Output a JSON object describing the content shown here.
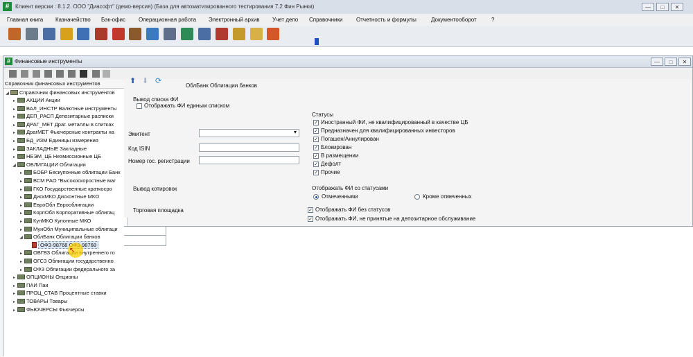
{
  "window": {
    "title": "Клиент версии : 8.1.2. ООО \"Диасофт\" (демо-версия) (База для автоматизированного тестирования 7.2 Фин Рынки)",
    "app_icon": "#",
    "controls": {
      "minimize": "—",
      "maximize": "□",
      "close": "✕"
    }
  },
  "menu": [
    "Главная книга",
    "Казначейство",
    "Бэк-офис",
    "Операционная работа",
    "Электронный архив",
    "Учет депо",
    "Справочники",
    "Отчетность и формулы",
    "Документооборот",
    "?"
  ],
  "toolbar_icons": [
    "people-icon",
    "calc-icon",
    "document-icon",
    "notebook-icon",
    "chart-icon",
    "book-icon",
    "car-icon",
    "users-icon",
    "computer-icon",
    "bank-icon",
    "cash-icon",
    "monitor-icon",
    "bag-icon",
    "box-icon",
    "documents-icon",
    "stamp-icon"
  ],
  "toolbar_colors": {
    "people-icon": "#c0662a",
    "calc-icon": "#6c7c8c",
    "document-icon": "#4a6fa5",
    "notebook-icon": "#d8a11c",
    "chart-icon": "#3f6fb5",
    "book-icon": "#a83b2b",
    "car-icon": "#c0392b",
    "users-icon": "#8a5a2b",
    "computer-icon": "#3a7bbf",
    "bank-icon": "#5f6f8a",
    "cash-icon": "#2e8b57",
    "monitor-icon": "#4a6fa5",
    "bag-icon": "#b03a2e",
    "box-icon": "#c49a2c",
    "documents-icon": "#d7b04a",
    "stamp-icon": "#d2582a"
  },
  "child_window": {
    "title": "Финансовые инструменты",
    "app_icon": "#",
    "controls": {
      "minimize": "—",
      "maximize": "□",
      "close": "✕"
    },
    "tools": [
      "list-icon",
      "filter-icon",
      "filter-off-icon",
      "search-icon",
      "print-icon",
      "zoom-icon",
      "binoculars-icon",
      "refresh-icon",
      "back-icon"
    ]
  },
  "tree": {
    "header": "Справочник финансовых инструментов",
    "root": "Справочник финансовых инструментов",
    "items": [
      {
        "label": "АКЦИИ Акции",
        "level": 1,
        "exp": "▸"
      },
      {
        "label": "ВАЛ_ИНСТР Валютные инструменты",
        "level": 1,
        "exp": "▸"
      },
      {
        "label": "ДЕП_РАСП Депозитарные расписки",
        "level": 1,
        "exp": "▸"
      },
      {
        "label": "ДРАГ_МЕТ Драг. металлы в слитках",
        "level": 1,
        "exp": "▸"
      },
      {
        "label": "ДрагМЕТ Фьючерсные контракты на",
        "level": 1,
        "exp": "▸"
      },
      {
        "label": "ЕД_ИЗМ Единицы измерения",
        "level": 1,
        "exp": "▸"
      },
      {
        "label": "ЗАКЛАДНЫЕ Закладные",
        "level": 1,
        "exp": "▸"
      },
      {
        "label": "НЕЭМ_ЦБ Неэмиссионные ЦБ",
        "level": 1,
        "exp": "▸"
      },
      {
        "label": "ОБЛИГАЦИИ Облигации",
        "level": 1,
        "exp": "◢"
      },
      {
        "label": "БОБР Бескупонные облигации Банк",
        "level": 2,
        "exp": "▸"
      },
      {
        "label": "ВСМ РАО \"Высокоскоростные маг",
        "level": 2,
        "exp": "▸"
      },
      {
        "label": "ГКО Государственные краткосро",
        "level": 2,
        "exp": "▸"
      },
      {
        "label": "ДискМКО Дисконтные МКО",
        "level": 2,
        "exp": "▸"
      },
      {
        "label": "ЕвроОбл Еврооблигации",
        "level": 2,
        "exp": "▸"
      },
      {
        "label": "КорпОбл Корпоративные облигац",
        "level": 2,
        "exp": "▸"
      },
      {
        "label": "КупМКО Купонные МКО",
        "level": 2,
        "exp": "▸"
      },
      {
        "label": "МунОбл Муниципальные облигаци",
        "level": 2,
        "exp": "▸"
      },
      {
        "label": "ОблБанк Облигации банков",
        "level": 2,
        "exp": "◢"
      },
      {
        "label": "ОФЗ-98768 ОФЗ-98768",
        "level": 3,
        "exp": "",
        "doc": true,
        "selected": true
      },
      {
        "label": "ОВГВЗ Облигации внутреннего го",
        "level": 2,
        "exp": "▸"
      },
      {
        "label": "ОГСЗ Облигации государственно",
        "level": 2,
        "exp": "▸"
      },
      {
        "label": "ОФЗ Облигации федерального за",
        "level": 2,
        "exp": "▸"
      },
      {
        "label": "ОПЦИОНЫ Опционы",
        "level": 1,
        "exp": "▸"
      },
      {
        "label": "ПАИ Паи",
        "level": 1,
        "exp": "▸"
      },
      {
        "label": "ПРОЦ_СТАВ Процентные ставки",
        "level": 1,
        "exp": "▸"
      },
      {
        "label": "ТОВАРЫ Товары",
        "level": 1,
        "exp": "▸"
      },
      {
        "label": "ФЬЮЧЕРСЫ Фьючерсы",
        "level": 1,
        "exp": "▸"
      }
    ]
  },
  "filter": {
    "path_label": "ОблБанк Облигации банков",
    "section_output": "Вывод списка ФИ",
    "single_list": "Отображать ФИ единым списком",
    "issuer_label": "Эмитент",
    "isin_label": "Код ISIN",
    "regnum_label": "Номер гос. регистрации",
    "quotes_label": "Вывод котировок",
    "trading_label": "Торговая площадка",
    "statuses_title": "Статусы",
    "statuses": [
      "Иностранный ФИ, не квалифицированный в качестве ЦБ",
      "Предназначен для квалифицированных инвесторов",
      "Погашен/Аннулирован",
      "Блокирован",
      "В размещении",
      "Дефолт",
      "Прочие"
    ],
    "show_with_status": "Отображать ФИ со статусами",
    "radio_marked": "Отмеченными",
    "radio_except": "Кроме отмеченных",
    "no_status": "Отображать ФИ без статусов",
    "not_accepted": "Отображать ФИ, не принятые на депозитарное обслуживание"
  }
}
